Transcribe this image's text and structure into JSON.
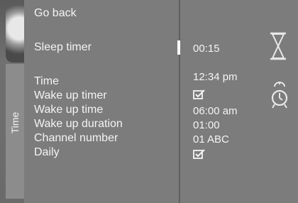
{
  "menu": {
    "tab_label": "Time",
    "back_label": "Go back",
    "sleep_timer": {
      "label": "Sleep timer",
      "value": "00:15"
    },
    "time": {
      "label": "Time",
      "value": "12:34 pm"
    },
    "wake_up_timer": {
      "label": "Wake up timer",
      "value_icon": "checkbox-checked-icon"
    },
    "wake_up_time": {
      "label": "Wake up time",
      "value": "06:00 am"
    },
    "wake_up_duration": {
      "label": "Wake up duration",
      "value": "01:00"
    },
    "channel_number": {
      "label": "Channel number",
      "value": "01 ABC"
    },
    "daily": {
      "label": "Daily",
      "value_icon": "checkbox-checked-icon"
    }
  },
  "icons": {
    "sleep_timer": "hourglass-icon",
    "wake_up_timer": "alarm-clock-icon"
  },
  "colors": {
    "panel": "#7c7c7c",
    "text": "#f4f4f4",
    "background": "#d9d9d9"
  }
}
